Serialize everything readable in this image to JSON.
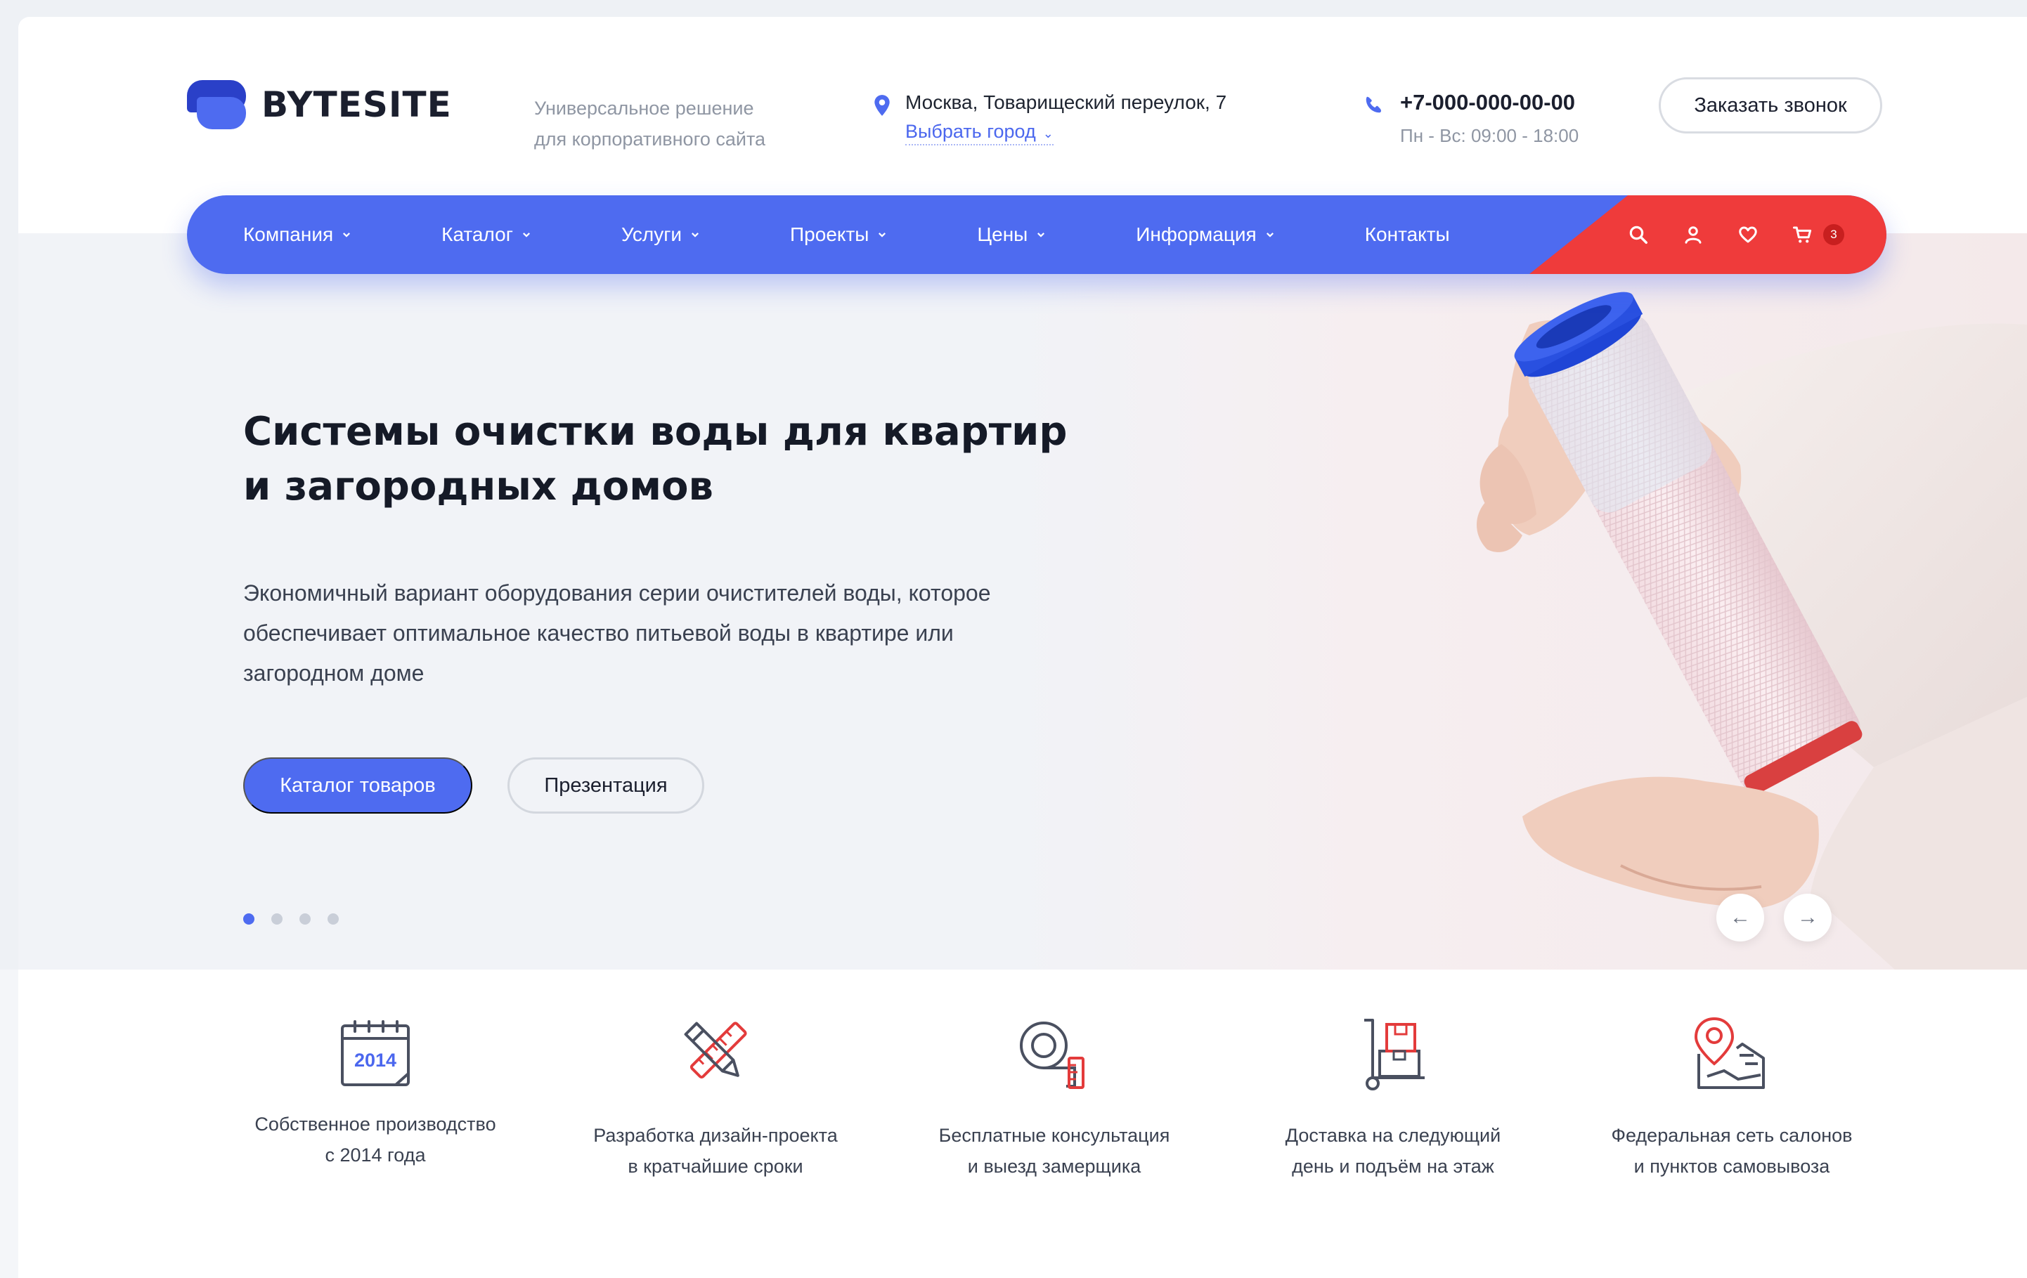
{
  "brand": {
    "name": "BYTESITE",
    "tagline_line1": "Универсальное решение",
    "tagline_line2": "для корпоративного сайта"
  },
  "header": {
    "address": "Москва, Товарищеский переулок, 7",
    "city_select": "Выбрать город",
    "phone": "+7-000-000-00-00",
    "hours": "Пн - Вс: 09:00 - 18:00",
    "callback_label": "Заказать звонок"
  },
  "nav": {
    "items": [
      {
        "label": "Компания",
        "dropdown": true
      },
      {
        "label": "Каталог",
        "dropdown": true
      },
      {
        "label": "Услуги",
        "dropdown": true
      },
      {
        "label": "Проекты",
        "dropdown": true
      },
      {
        "label": "Цены",
        "dropdown": true
      },
      {
        "label": "Информация",
        "dropdown": true
      },
      {
        "label": "Контакты",
        "dropdown": false
      }
    ],
    "cart_count": "3"
  },
  "hero": {
    "title_line1": "Системы очистки воды для квартир",
    "title_line2": "и загородных домов",
    "desc_line1": "Экономичный вариант оборудования серии очистителей воды, которое",
    "desc_line2": "обеспечивает оптимальное качество питьевой воды в квартире или",
    "desc_line3": "загородном доме",
    "primary_button": "Каталог товаров",
    "secondary_button": "Презентация",
    "slides_total": 4,
    "active_slide": 1
  },
  "features": [
    {
      "icon": "calendar-icon",
      "badge": "2014",
      "line1": "Собственное производство",
      "line2": "с 2014 года"
    },
    {
      "icon": "design-tools-icon",
      "line1": "Разработка дизайн-проекта",
      "line2": "в кратчайшие сроки"
    },
    {
      "icon": "tape-measure-icon",
      "line1": "Бесплатные консультация",
      "line2": "и выезд замерщика"
    },
    {
      "icon": "hand-truck-icon",
      "line1": "Доставка на следующий",
      "line2": "день и подъём на этаж"
    },
    {
      "icon": "map-pin-icon",
      "line1": "Федеральная сеть салонов",
      "line2": "и пунктов самовывоза"
    }
  ],
  "colors": {
    "accent": "#4e6bf0",
    "red": "#ef3b3b",
    "text": "#1b1f2e",
    "muted": "#8f96a3"
  }
}
